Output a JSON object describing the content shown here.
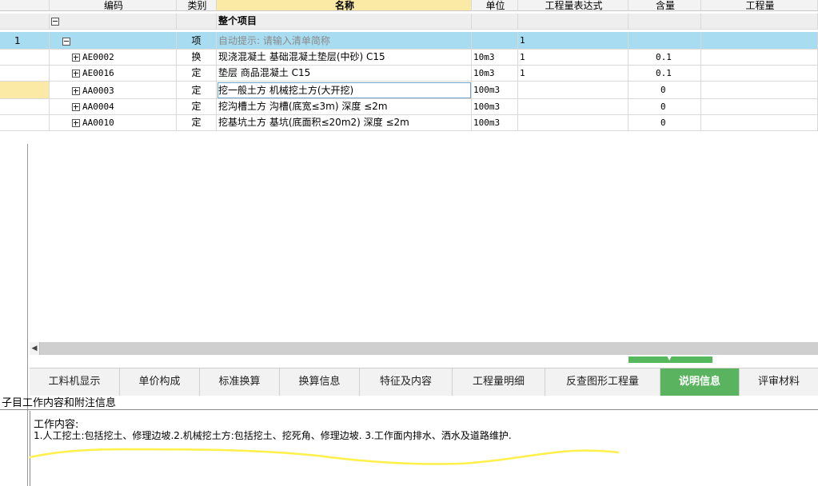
{
  "columns": [
    {
      "key": "index",
      "label": ""
    },
    {
      "key": "code",
      "label": "编码"
    },
    {
      "key": "type",
      "label": "类别"
    },
    {
      "key": "name",
      "label": "名称"
    },
    {
      "key": "unit",
      "label": "单位"
    },
    {
      "key": "expr",
      "label": "工程量表达式"
    },
    {
      "key": "content",
      "label": "含量"
    },
    {
      "key": "qty",
      "label": "工程量"
    }
  ],
  "rows": [
    {
      "kind": "project",
      "index": "",
      "code": "",
      "type": "",
      "name": "整个项目",
      "unit": "",
      "expr": "",
      "content": "",
      "qty": "",
      "expander": "minus"
    },
    {
      "kind": "item",
      "index": "1",
      "code": "",
      "type": "项",
      "name": "自动提示: 请输入清单简称",
      "unit": "",
      "expr": "1",
      "content": "",
      "qty": "",
      "expander": "minus"
    },
    {
      "kind": "quota",
      "index": "",
      "code": "AE0002",
      "type": "换",
      "name": "现浇混凝土 基础混凝土垫层(中砂) C15",
      "unit": "10m3",
      "expr": "1",
      "content": "0.1",
      "qty": "",
      "expander": "plus"
    },
    {
      "kind": "quota",
      "index": "",
      "code": "AE0016",
      "type": "定",
      "name": "垫层 商品混凝土 C15",
      "unit": "10m3",
      "expr": "1",
      "content": "0.1",
      "qty": "",
      "expander": "plus"
    },
    {
      "kind": "quota",
      "selected": true,
      "index": "",
      "code": "AA0003",
      "type": "定",
      "name": "挖一般土方 机械挖土方(大开挖)",
      "unit": "100m3",
      "expr": "",
      "content": "0",
      "qty": "",
      "expander": "plus"
    },
    {
      "kind": "quota",
      "index": "",
      "code": "AA0004",
      "type": "定",
      "name": "挖沟槽土方 沟槽(底宽≤3m) 深度 ≤2m",
      "unit": "100m3",
      "expr": "",
      "content": "0",
      "qty": "",
      "expander": "plus"
    },
    {
      "kind": "quota",
      "index": "",
      "code": "AA0010",
      "type": "定",
      "name": "挖基坑土方 基坑(底面积≤20m2) 深度 ≤2m",
      "unit": "100m3",
      "expr": "",
      "content": "0",
      "qty": "",
      "expander": "plus"
    }
  ],
  "tabs": [
    {
      "label": "工料机显示",
      "active": false
    },
    {
      "label": "单价构成",
      "active": false
    },
    {
      "label": "标准换算",
      "active": false
    },
    {
      "label": "换算信息",
      "active": false
    },
    {
      "label": "特征及内容",
      "active": false
    },
    {
      "label": "工程量明细",
      "active": false
    },
    {
      "label": "反查图形工程量",
      "active": false
    },
    {
      "label": "说明信息",
      "active": true
    },
    {
      "label": "评审材料",
      "active": false
    }
  ],
  "panel": {
    "title": "子目工作内容和附注信息",
    "label": "工作内容:",
    "text": "1.人工挖土:包括挖土、修理边坡.2.机械挖土方:包括挖土、挖死角、修理边坡. 3.工作面内排水、洒水及道路维护."
  },
  "colors": {
    "item_row": "#a8dcf0",
    "active_tab": "#5ab45f",
    "header_name": "#fbe9a6",
    "highlight": "#fff04a"
  }
}
